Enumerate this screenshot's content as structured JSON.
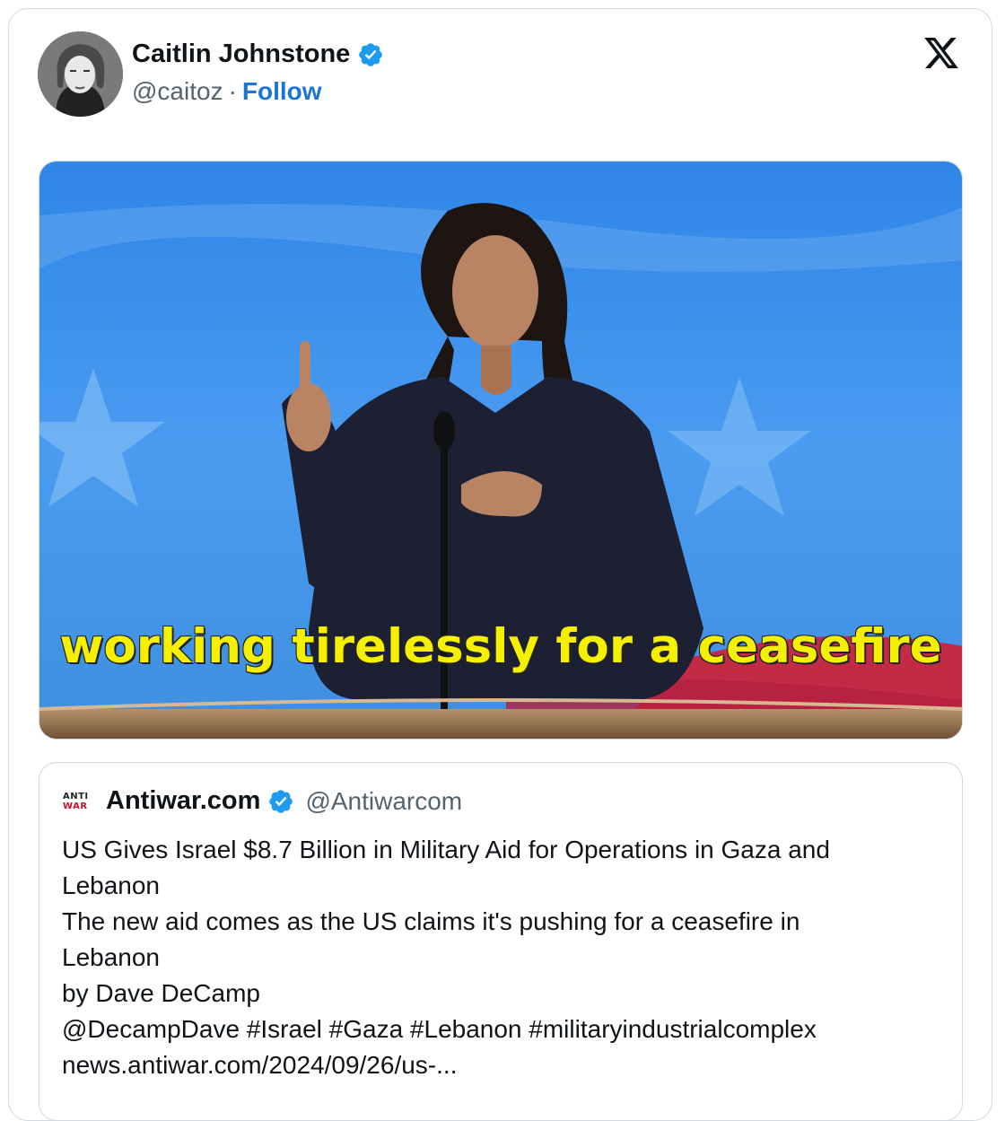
{
  "tweet": {
    "author_name": "Caitlin Johnstone",
    "author_handle": "@caitoz",
    "separator": "·",
    "follow_label": "Follow",
    "media_caption": "working tirelessly for a ceasefire"
  },
  "quoted": {
    "logo_line1": "ANTI",
    "logo_line2": "WAR",
    "author_name": "Antiwar.com",
    "author_handle": "@Antiwarcom",
    "lines": [
      "US Gives Israel $8.7 Billion in Military Aid for Operations in Gaza and",
      "Lebanon",
      "The new aid comes as the US claims it's pushing for a ceasefire in",
      "Lebanon",
      "by Dave DeCamp",
      "@DecampDave #Israel #Gaza #Lebanon #militaryindustrialcomplex",
      "news.antiwar.com/2024/09/26/us-..."
    ]
  },
  "colors": {
    "accent": "#1d74d8",
    "verified": "#1d9bf0",
    "caption": "#f4f000",
    "stage_blue": "#3a8ee6"
  },
  "icons": [
    "verified-badge-icon",
    "x-logo-icon",
    "antiwar-logo-icon"
  ]
}
